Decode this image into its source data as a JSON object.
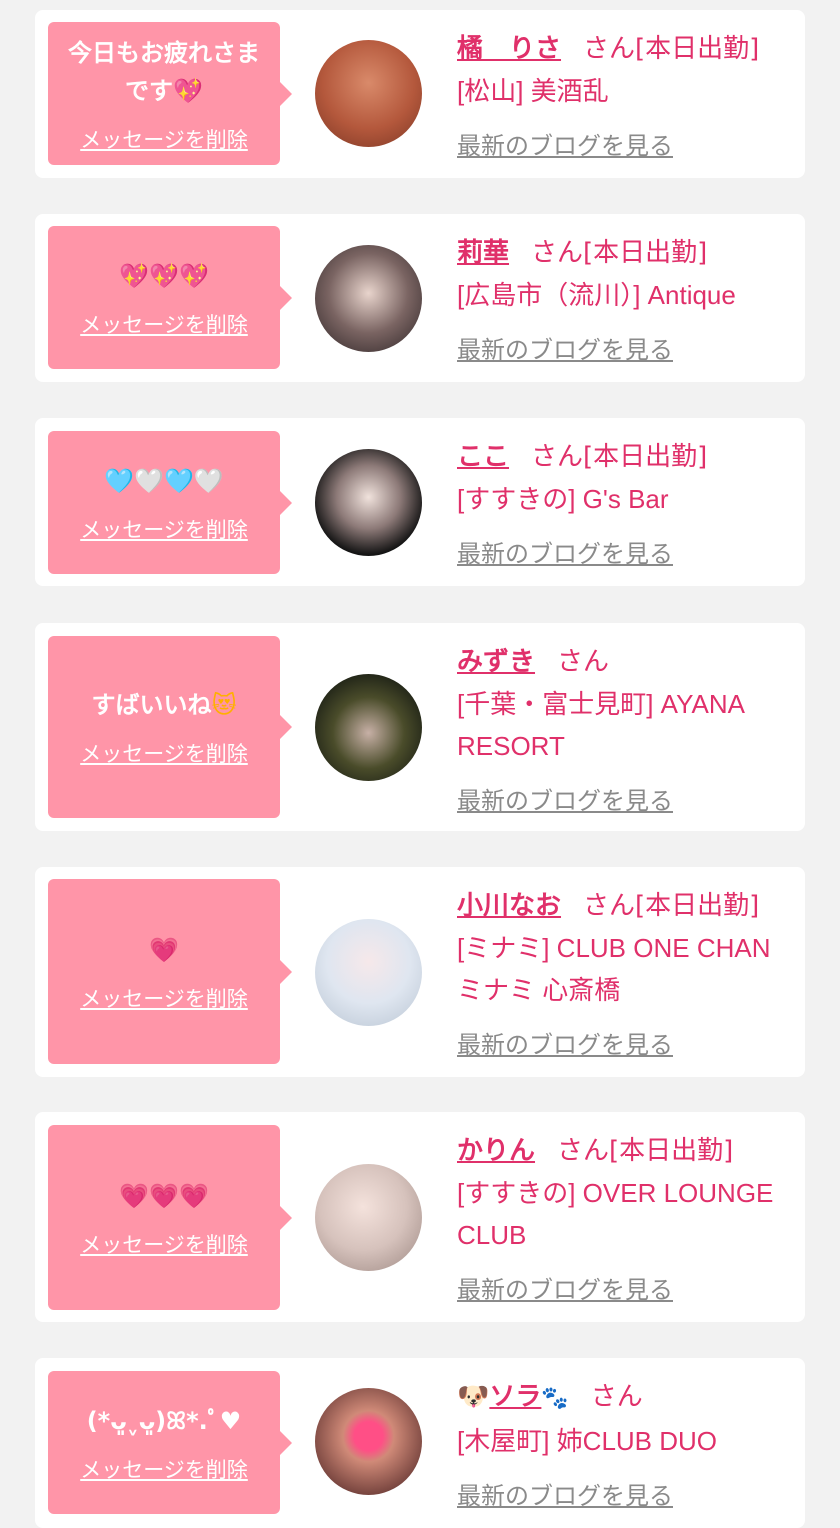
{
  "common": {
    "delete_label": "メッセージを削除",
    "blog_label": "最新のブログを見る",
    "san": "さん"
  },
  "colors": {
    "bubble": "#ff95a8",
    "accent": "#e0306a",
    "link_gray": "#8a8a8a",
    "background": "#f2f2f2"
  },
  "cards": [
    {
      "message": "今日もお疲れさまです",
      "message_emoji": "💖",
      "name": "橘　りさ",
      "status": "[本日出勤]",
      "shop": "[松山] 美酒乱",
      "avatar": "avatar-photo"
    },
    {
      "message": "",
      "message_emoji": "💖💖💖",
      "name": "莉華",
      "status": "[本日出勤]",
      "shop": "[広島市（流川）] Antique",
      "avatar": "avatar-photo"
    },
    {
      "message": "",
      "message_emoji": "🩵🤍🩵🤍",
      "name": "ここ",
      "status": "[本日出勤]",
      "shop": "[すすきの] G's Bar",
      "avatar": "avatar-photo"
    },
    {
      "message": "すばいいね",
      "message_emoji": "😻",
      "name": "みずき",
      "status": "",
      "shop": "[千葉・富士見町] AYANA RESORT",
      "avatar": "avatar-photo"
    },
    {
      "message": "",
      "message_emoji": "💗",
      "name": "小川なお",
      "status": "[本日出勤]",
      "shop": "[ミナミ] CLUB ONE CHAN ミナミ 心斎橋",
      "avatar": "avatar-photo"
    },
    {
      "message": "",
      "message_emoji": "💗💗💗",
      "name": "かりん",
      "status": "[本日出勤]",
      "shop": "[すすきの] OVER LOUNGE CLUB",
      "avatar": "avatar-photo"
    },
    {
      "message": "(*ᴗ͈ˬᴗ͈)ꕤ*.ﾟ",
      "message_emoji": "♥",
      "name": "ソラ",
      "name_prefix_emoji": "🐶",
      "name_suffix_emoji": "🐾",
      "status": "",
      "shop": "[木屋町] 姉CLUB DUO",
      "avatar": "avatar-photo"
    }
  ]
}
